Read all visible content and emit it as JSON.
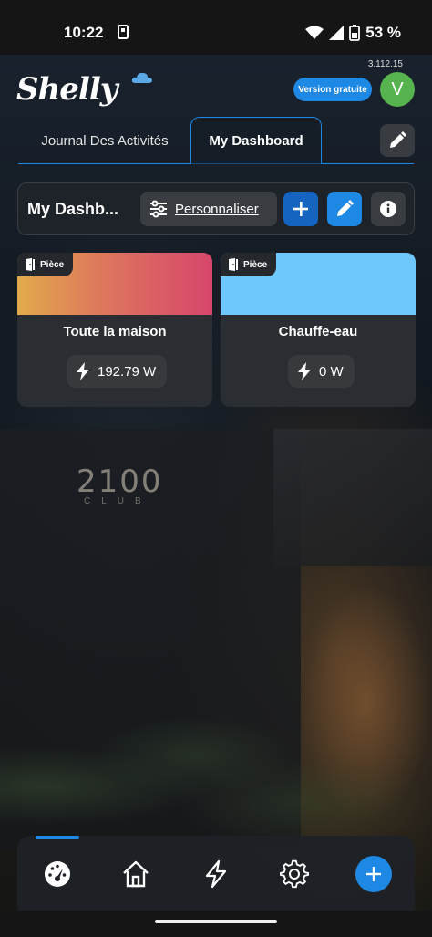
{
  "status_bar": {
    "time": "10:22",
    "battery": "53 %"
  },
  "app": {
    "version": "3.112.15",
    "logo_text": "Shelly",
    "free_badge": "Version gratuite",
    "avatar_initial": "V"
  },
  "tabs": [
    {
      "label": "Journal Des Activités",
      "active": false
    },
    {
      "label": "My Dashboard",
      "active": true
    }
  ],
  "toolbar": {
    "title": "My Dashb...",
    "customize_label": "Personnaliser"
  },
  "cards": [
    {
      "tag": "Pièce",
      "name": "Toute la maison",
      "power": "192.79 W"
    },
    {
      "tag": "Pièce",
      "name": "Chauffe-eau",
      "power": "0 W"
    }
  ],
  "background_sign": {
    "main": "2100",
    "sub": "CLUB"
  },
  "colors": {
    "accent": "#1e88e5",
    "avatar": "#56b34e",
    "card_bg": "#2a2d31"
  },
  "nav_icons": [
    "dashboard-icon",
    "home-icon",
    "energy-icon",
    "settings-icon",
    "add-icon"
  ]
}
